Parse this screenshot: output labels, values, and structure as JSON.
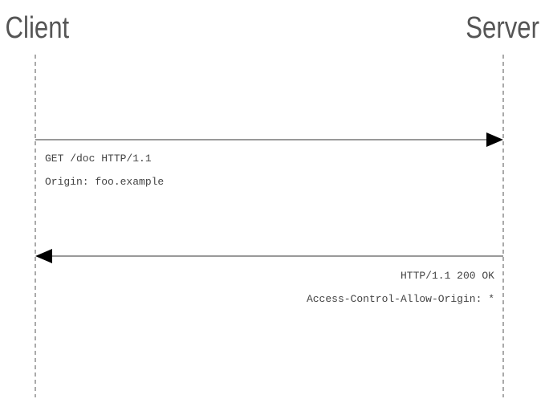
{
  "actors": {
    "client": "Client",
    "server": "Server"
  },
  "messages": [
    {
      "from": "Client",
      "to": "Server",
      "lines": [
        "GET /doc HTTP/1.1",
        "Origin: foo.example"
      ]
    },
    {
      "from": "Server",
      "to": "Client",
      "lines": [
        "HTTP/1.1 200 OK",
        "Access-Control-Allow-Origin: *"
      ]
    }
  ],
  "colors": {
    "text": "#444444",
    "actor_text": "#555555",
    "arrow": "#000000"
  }
}
